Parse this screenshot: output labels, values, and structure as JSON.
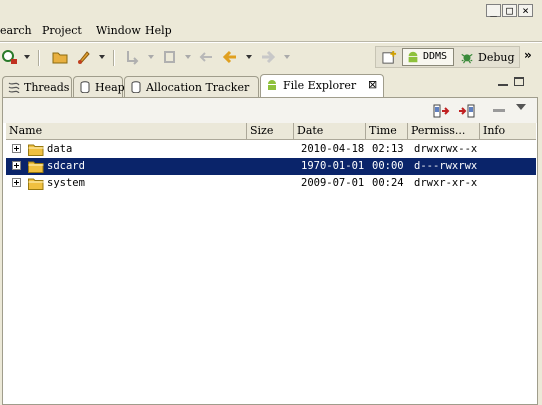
{
  "window_controls": {
    "minimize": "_",
    "maximize": "□",
    "close": "×"
  },
  "menu": [
    {
      "label": "earch"
    },
    {
      "label": "Project"
    },
    {
      "label": "Window"
    },
    {
      "label": "Help"
    }
  ],
  "perspectives": {
    "ddms": {
      "label": "DDMS",
      "icon": "android-icon"
    },
    "debug": {
      "label": "Debug",
      "icon": "debug-icon"
    },
    "overflow": "»"
  },
  "tabs": [
    {
      "label": "Threads",
      "icon": "threads-icon"
    },
    {
      "label": "Heap",
      "icon": "heap-icon"
    },
    {
      "label": "Allocation Tracker",
      "icon": "allocation-icon"
    },
    {
      "label": "File Explorer",
      "icon": "android-icon",
      "active": true,
      "close": "⊠"
    }
  ],
  "table": {
    "columns": [
      "Name",
      "Size",
      "Date",
      "Time",
      "Permiss...",
      "Info"
    ],
    "rows": [
      {
        "name": "data",
        "size": "",
        "date": "2010-04-18",
        "time": "02:13",
        "permissions": "drwxrwx--x",
        "info": "",
        "selected": false
      },
      {
        "name": "sdcard",
        "size": "",
        "date": "1970-01-01",
        "time": "00:00",
        "permissions": "d---rwxrwx",
        "info": "",
        "selected": true
      },
      {
        "name": "system",
        "size": "",
        "date": "2009-07-01",
        "time": "00:24",
        "permissions": "drwxr-xr-x",
        "info": "",
        "selected": false
      }
    ]
  },
  "colors": {
    "selection": "#0a246a",
    "folder": "#f0c040",
    "android": "#8ec13c"
  }
}
